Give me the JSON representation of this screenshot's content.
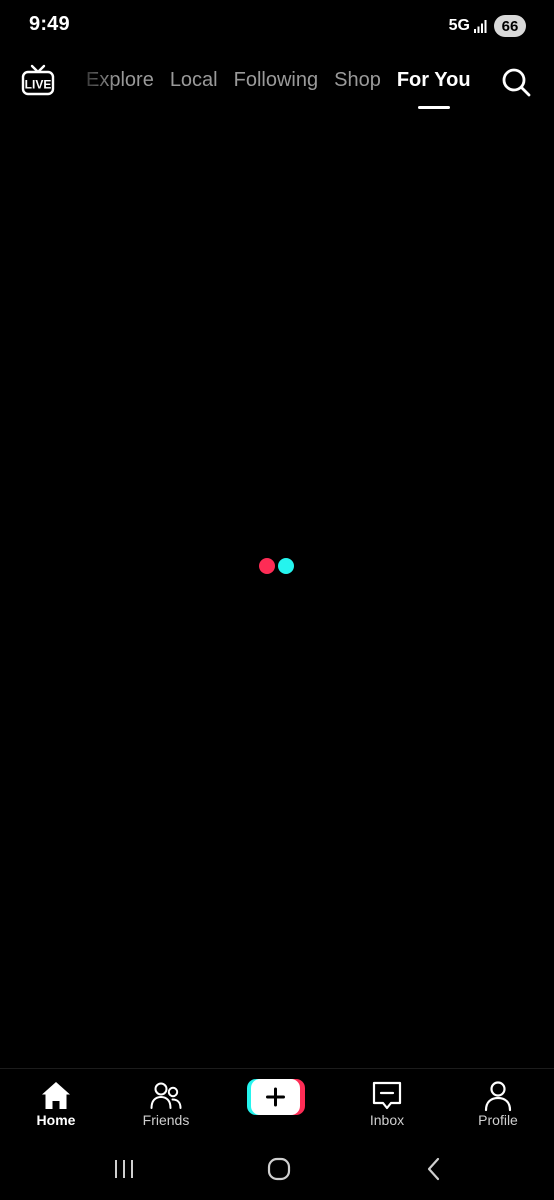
{
  "status_bar": {
    "time": "9:49",
    "network": "5G",
    "battery": "66",
    "icons": [
      "signal-icon"
    ]
  },
  "top_nav": {
    "live_icon": "live-tv-icon",
    "live_label": "LIVE",
    "tabs": [
      {
        "label": "Explore",
        "active": false
      },
      {
        "label": "Local",
        "active": false
      },
      {
        "label": "Following",
        "active": false
      },
      {
        "label": "Shop",
        "active": false
      },
      {
        "label": "For You",
        "active": true
      }
    ],
    "search_icon": "search-icon"
  },
  "loader": {
    "colors": {
      "left": "#fe2c55",
      "right": "#25f4ee"
    }
  },
  "tab_bar": {
    "items": [
      {
        "label": "Home",
        "icon": "home-icon",
        "active": true
      },
      {
        "label": "Friends",
        "icon": "friends-icon",
        "active": false
      },
      {
        "label": "",
        "icon": "plus-icon",
        "active": false
      },
      {
        "label": "Inbox",
        "icon": "inbox-icon",
        "active": false
      },
      {
        "label": "Profile",
        "icon": "profile-icon",
        "active": false
      }
    ]
  },
  "system_nav": {
    "icons": [
      "recent-apps-icon",
      "home-circle-icon",
      "back-chevron-icon"
    ]
  },
  "colors": {
    "background": "#000000",
    "accent_red": "#fe2c55",
    "accent_cyan": "#25f4ee",
    "active_text": "#ffffff",
    "inactive_text": "#9a9a9a"
  }
}
